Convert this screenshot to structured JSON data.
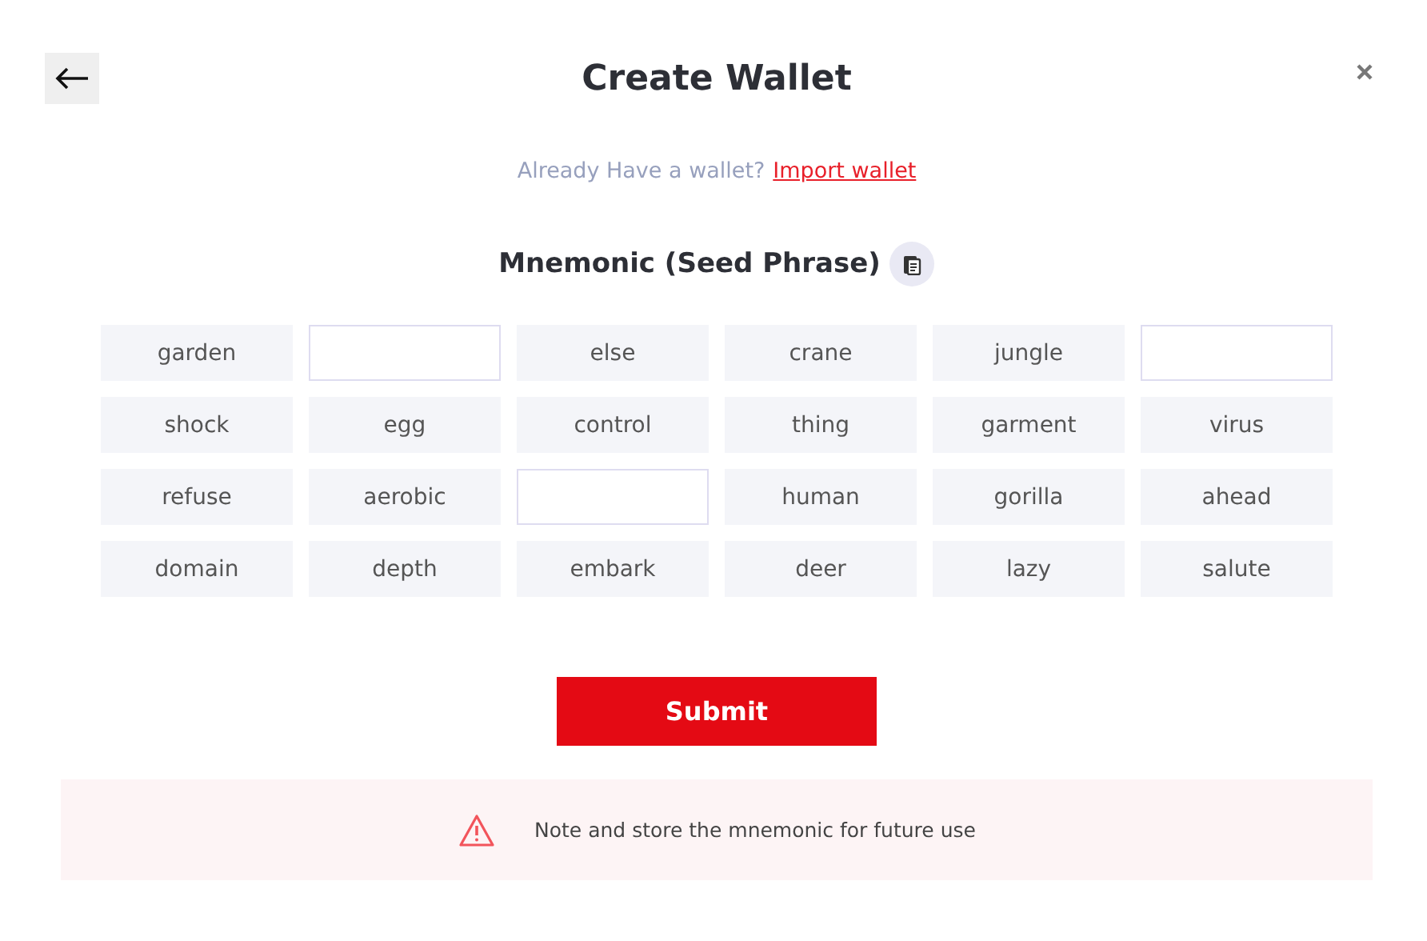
{
  "title": "Create Wallet",
  "import_prompt": {
    "text": "Already Have a wallet?",
    "link": "Import wallet"
  },
  "heading": "Mnemonic (Seed Phrase)",
  "words": [
    {
      "kind": "word",
      "text": "garden"
    },
    {
      "kind": "blank"
    },
    {
      "kind": "word",
      "text": "else"
    },
    {
      "kind": "word",
      "text": "crane"
    },
    {
      "kind": "word",
      "text": "jungle"
    },
    {
      "kind": "blank"
    },
    {
      "kind": "word",
      "text": "shock"
    },
    {
      "kind": "word",
      "text": "egg"
    },
    {
      "kind": "word",
      "text": "control"
    },
    {
      "kind": "word",
      "text": "thing"
    },
    {
      "kind": "word",
      "text": "garment"
    },
    {
      "kind": "word",
      "text": "virus"
    },
    {
      "kind": "word",
      "text": "refuse"
    },
    {
      "kind": "word",
      "text": "aerobic"
    },
    {
      "kind": "blank"
    },
    {
      "kind": "word",
      "text": "human"
    },
    {
      "kind": "word",
      "text": "gorilla"
    },
    {
      "kind": "word",
      "text": "ahead"
    },
    {
      "kind": "word",
      "text": "domain"
    },
    {
      "kind": "word",
      "text": "depth"
    },
    {
      "kind": "word",
      "text": "embark"
    },
    {
      "kind": "word",
      "text": "deer"
    },
    {
      "kind": "word",
      "text": "lazy"
    },
    {
      "kind": "word",
      "text": "salute"
    }
  ],
  "submit": "Submit",
  "note": "Note and store the mnemonic for future use"
}
